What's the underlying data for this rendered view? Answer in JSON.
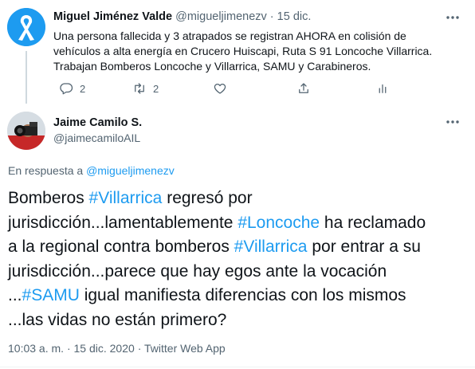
{
  "parent_tweet": {
    "name": "Miguel Jiménez Valde",
    "handle": "@migueljimenezv",
    "separator": "·",
    "date": "15 dic.",
    "text_lines": [
      "Una persona fallecida y 3 atrapados se registran AHORA en colisión de",
      "vehículos a alta energía en Crucero Huiscapi, Ruta S 91 Loncoche Villarrica.",
      "Trabajan Bomberos Loncoche y Villarrica, SAMU y Carabineros."
    ],
    "reply_count": "2",
    "retweet_count": "2",
    "avatar_icon": "awareness-ribbon-icon",
    "accent_color": "#1d9bf0"
  },
  "main_tweet": {
    "name": "Jaime Camilo S.",
    "handle": "@jaimecamiloAIL",
    "reply_prefix": "En respuesta a",
    "reply_handle": "@migueljimenezv",
    "text_segments": [
      [
        {
          "t": "Bomberos ",
          "tag": false
        },
        {
          "t": "#Villarrica",
          "tag": true
        },
        {
          "t": " regresó por",
          "tag": false
        }
      ],
      [
        {
          "t": "jurisdicción...lamentablemente ",
          "tag": false
        },
        {
          "t": "#Loncoche",
          "tag": true
        },
        {
          "t": " ha reclamado",
          "tag": false
        }
      ],
      [
        {
          "t": "a la regional contra bomberos ",
          "tag": false
        },
        {
          "t": "#Villarrica",
          "tag": true
        },
        {
          "t": " por entrar a su",
          "tag": false
        }
      ],
      [
        {
          "t": "jurisdicción...parece que hay egos ante la vocación",
          "tag": false
        }
      ],
      [
        {
          "t": "...",
          "tag": false
        },
        {
          "t": "#SAMU",
          "tag": true
        },
        {
          "t": " igual manifiesta diferencias con los mismos",
          "tag": false
        }
      ],
      [
        {
          "t": "...las vidas no están primero?",
          "tag": false
        }
      ]
    ],
    "time": "10:03 a. m.",
    "separator": "·",
    "date": "15 dic. 2020",
    "source": "Twitter Web App",
    "avatar_icon": "camera-operator-avatar"
  }
}
